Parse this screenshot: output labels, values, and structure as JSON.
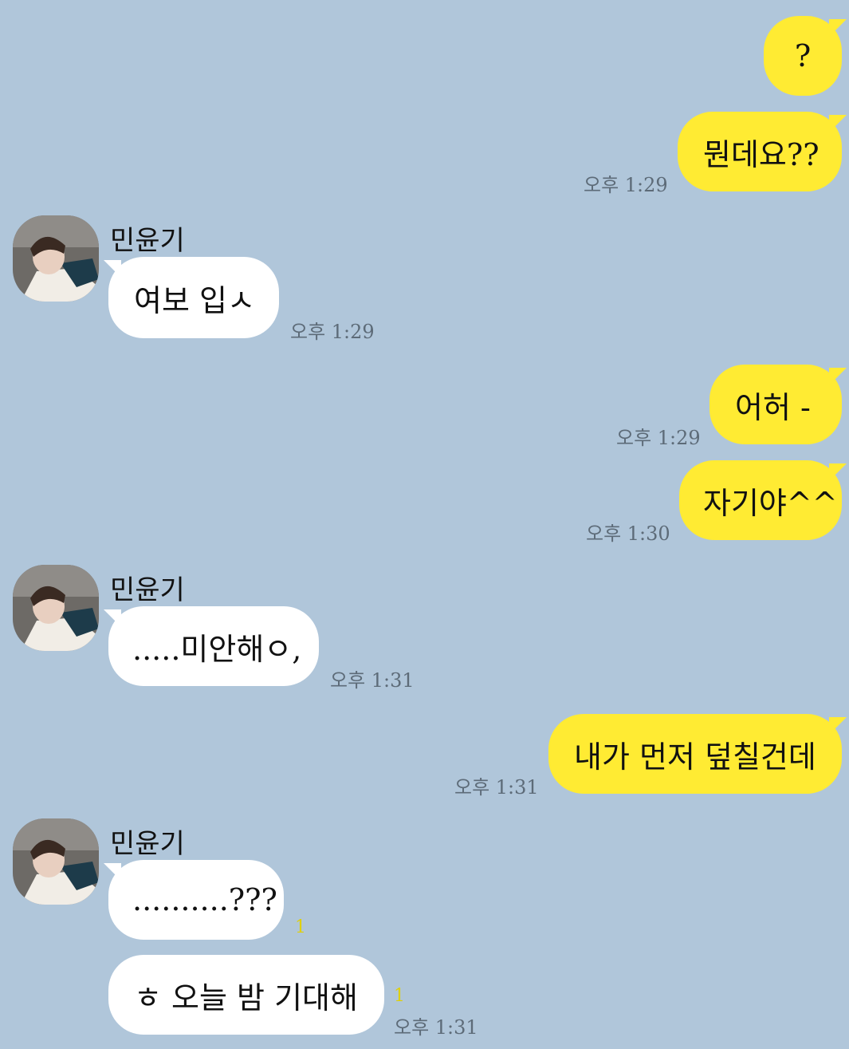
{
  "chat": {
    "partner_name": "민윤기",
    "messages": [
      {
        "from": "me",
        "text": "?",
        "time": ""
      },
      {
        "from": "me",
        "text": "뭔데요??",
        "time": "오후 1:29"
      },
      {
        "from": "them",
        "text": "여보 입ㅅ",
        "time": "오후 1:29"
      },
      {
        "from": "me",
        "text": "어허 -",
        "time": "오후 1:29"
      },
      {
        "from": "me",
        "text": "자기야^^",
        "time": "오후 1:30"
      },
      {
        "from": "them",
        "text": ".....미안해ㅇ,",
        "time": "오후 1:31"
      },
      {
        "from": "me",
        "text": "내가 먼저 덮칠건데",
        "time": "오후 1:31"
      },
      {
        "from": "them",
        "text": "..........???",
        "time": "",
        "unread": "1"
      },
      {
        "from": "them",
        "text": "ㅎ 오늘 밤 기대해",
        "time": "오후 1:31",
        "unread": "1"
      }
    ]
  },
  "colors": {
    "background": "#b0c6da",
    "my_bubble": "#ffeb33",
    "their_bubble": "#ffffff",
    "unread": "#e0d000"
  },
  "icons": {
    "avatar": "profile-photo"
  }
}
